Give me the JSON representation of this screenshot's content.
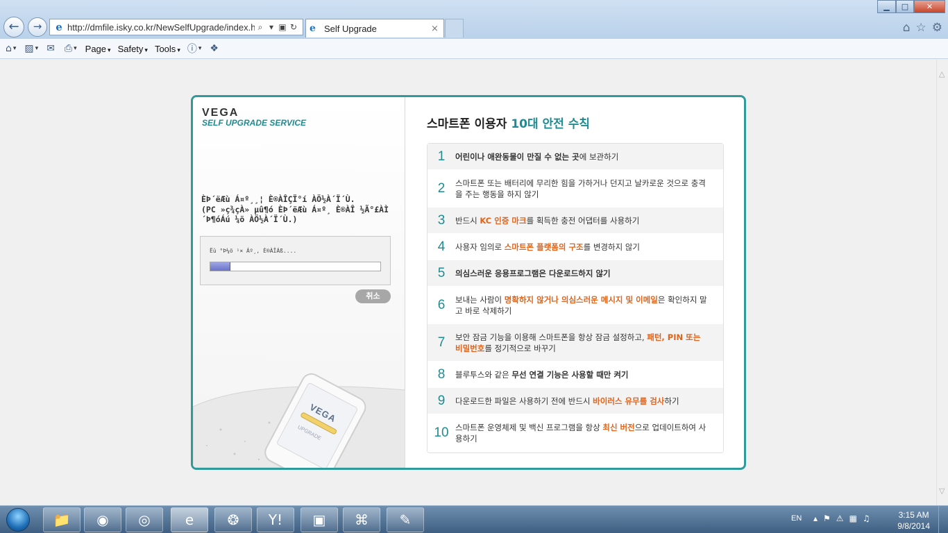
{
  "browser": {
    "url": "http://dmfile.isky.co.kr/NewSelfUpgrade/index.htm",
    "tab_title": "Self Upgrade",
    "tab_close": "×",
    "commands": [
      "Page",
      "Safety",
      "Tools"
    ],
    "caret": "▾"
  },
  "left_panel": {
    "logo": "VEGA",
    "service": "SELF UPGRADE SERVICE",
    "status_message": "ÈÞ´ëÆù Á¤º¸¸¦ È®ÀÎÇÏ°í ÀÖ½À´Ï´Ù.\n(PC »ç¾çÀ» µû¶ó ÈÞ´ëÆù Á¤º¸ È®ÀÎ ½Ã°£ÀÌ\n´Þ¶óÁú ¼ö ÀÖ½À´Ï´Ù.)",
    "progress_caption": "Ëù °Þ¼ö ¹× Áº¸, È®ÀÎÁß....",
    "progress_fraction": 0.12,
    "cancel_label": "취소",
    "phone_logo": "VEGA",
    "phone_caption": "UPGRADE"
  },
  "right_panel": {
    "title_prefix": "스마트폰 이용자 ",
    "title_accent": "10대 안전 수칙",
    "rules": [
      {
        "num": "1",
        "parts": [
          {
            "t": "어린이나 애완동물이 만질 수 없는 곳",
            "s": "bd"
          },
          {
            "t": "에 보관하기",
            "s": ""
          }
        ]
      },
      {
        "num": "2",
        "parts": [
          {
            "t": "스마트폰 또는 배터리에 무리한 힘을 가하거나 던지고 날카로운 것으로 충격을 주는 행동을 하지 않기",
            "s": ""
          }
        ]
      },
      {
        "num": "3",
        "parts": [
          {
            "t": "반드시 ",
            "s": ""
          },
          {
            "t": "KC 인증 마크",
            "s": "hl"
          },
          {
            "t": "를 획득한 충전 어댑터를 사용하기",
            "s": ""
          }
        ]
      },
      {
        "num": "4",
        "parts": [
          {
            "t": "사용자 임의로 ",
            "s": ""
          },
          {
            "t": "스마트폰 플랫폼의 구조",
            "s": "hl"
          },
          {
            "t": "를 변경하지 않기",
            "s": ""
          }
        ]
      },
      {
        "num": "5",
        "parts": [
          {
            "t": "의심스러운 응용프로그램은 다운로드하지 않기",
            "s": "bd"
          }
        ]
      },
      {
        "num": "6",
        "parts": [
          {
            "t": "보내는 사람이 ",
            "s": ""
          },
          {
            "t": "명확하지 않거나 의심스러운 메시지 및 이메일",
            "s": "hl"
          },
          {
            "t": "은 확인하지 말고 바로 삭제하기",
            "s": ""
          }
        ]
      },
      {
        "num": "7",
        "parts": [
          {
            "t": "보안 잠금 기능을 이용해 스마트폰을 항상 잠금 설정하고, ",
            "s": ""
          },
          {
            "t": "패턴, PIN 또는 비밀번호",
            "s": "hl"
          },
          {
            "t": "를 정기적으로 바꾸기",
            "s": ""
          }
        ]
      },
      {
        "num": "8",
        "parts": [
          {
            "t": "블루투스와 같은 ",
            "s": ""
          },
          {
            "t": "무선 연결 기능은 사용할 때만 켜기",
            "s": "bd"
          }
        ]
      },
      {
        "num": "9",
        "parts": [
          {
            "t": "다운로드한 파일은 사용하기 전에 반드시 ",
            "s": ""
          },
          {
            "t": "바이러스 유무를 검사",
            "s": "hl"
          },
          {
            "t": "하기",
            "s": ""
          }
        ]
      },
      {
        "num": "10",
        "parts": [
          {
            "t": "스마트폰 운영체제 및 백신 프로그램을 항상 ",
            "s": ""
          },
          {
            "t": "최신 버전",
            "s": "hl"
          },
          {
            "t": "으로 업데이트하여 사용하기",
            "s": ""
          }
        ]
      }
    ]
  },
  "taskbar": {
    "apps": [
      "file-explorer-icon",
      "firefox-icon",
      "chrome-icon",
      "internet-explorer-icon",
      "green-app-icon",
      "yahoo-messenger-icon",
      "network-computer-icon",
      "xampp-icon",
      "paint-icon"
    ],
    "lang": "EN",
    "time": "3:15 AM",
    "date": "9/8/2014"
  },
  "colors": {
    "accent": "#1f8b92",
    "highlight": "#e0641b",
    "frame": "#2f9a9a"
  }
}
